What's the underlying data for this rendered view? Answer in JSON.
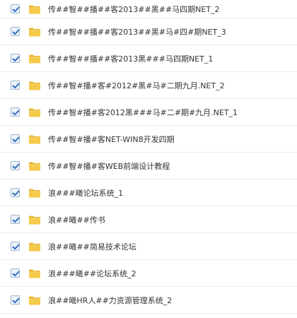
{
  "file_list": {
    "items": [
      {
        "name": "传##智##播##客2013##黑##马四期NET_2",
        "checked": true,
        "icon": "folder-icon"
      },
      {
        "name": "传##智##播##客2013##黑#马#四#期NET_3",
        "checked": true,
        "icon": "folder-icon"
      },
      {
        "name": "传##智##播##客2013黑###马四期NET_1",
        "checked": true,
        "icon": "folder-icon"
      },
      {
        "name": "传##智#播#客#2012#黑#马#二期九月.NET_2",
        "checked": true,
        "icon": "folder-icon"
      },
      {
        "name": "传##智#播#客2012黑###马#二#期#九月.NET_1",
        "checked": true,
        "icon": "folder-icon"
      },
      {
        "name": "传##智#播#客NET-WIN8开发四期",
        "checked": true,
        "icon": "folder-icon"
      },
      {
        "name": "传##智#播#客WEB前端设计教程",
        "checked": true,
        "icon": "folder-icon"
      },
      {
        "name": "浪###曦论坛系统_1",
        "checked": true,
        "icon": "folder-icon"
      },
      {
        "name": "浪##曦##传书",
        "checked": true,
        "icon": "folder-icon"
      },
      {
        "name": "浪##曦##简易技术论坛",
        "checked": true,
        "icon": "folder-icon"
      },
      {
        "name": "浪###曦##论坛系统_2",
        "checked": true,
        "icon": "folder-icon"
      },
      {
        "name": "浪##曦HR人##力资源管理系统_2",
        "checked": true,
        "icon": "folder-icon"
      }
    ]
  },
  "colors": {
    "check": "#2f6fc0",
    "folder_body": "#f5c94a",
    "folder_tab": "#e8b534",
    "row_border": "#e6ebf2"
  }
}
